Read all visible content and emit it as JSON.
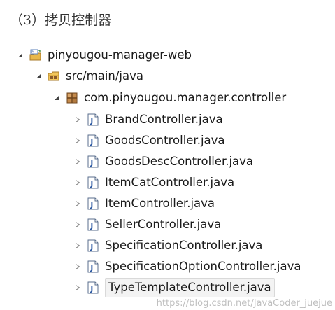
{
  "heading": "（3）拷贝控制器",
  "tree": {
    "project": {
      "label": "pinyougou-manager-web",
      "icon": "web-project-icon",
      "expanded": true
    },
    "source_folder": {
      "label": "src/main/java",
      "icon": "source-folder-icon",
      "expanded": true
    },
    "package": {
      "label": "com.pinyougou.manager.controller",
      "icon": "package-icon",
      "expanded": true
    },
    "files": [
      {
        "label": "BrandController.java",
        "icon": "java-file-icon"
      },
      {
        "label": "GoodsController.java",
        "icon": "java-file-icon"
      },
      {
        "label": "GoodsDescController.java",
        "icon": "java-file-icon"
      },
      {
        "label": "ItemCatController.java",
        "icon": "java-file-icon"
      },
      {
        "label": "ItemController.java",
        "icon": "java-file-icon"
      },
      {
        "label": "SellerController.java",
        "icon": "java-file-icon"
      },
      {
        "label": "SpecificationController.java",
        "icon": "java-file-icon"
      },
      {
        "label": "SpecificationOptionController.java",
        "icon": "java-file-icon"
      },
      {
        "label": "TypeTemplateController.java",
        "icon": "java-file-icon",
        "selected": true
      }
    ]
  },
  "watermark": "https://blog.csdn.net/JavaCoder_juejue",
  "colors": {
    "package_brown": "#8a5a2b",
    "folder_yellow": "#e8b84a",
    "java_blue": "#1f4e9c"
  }
}
